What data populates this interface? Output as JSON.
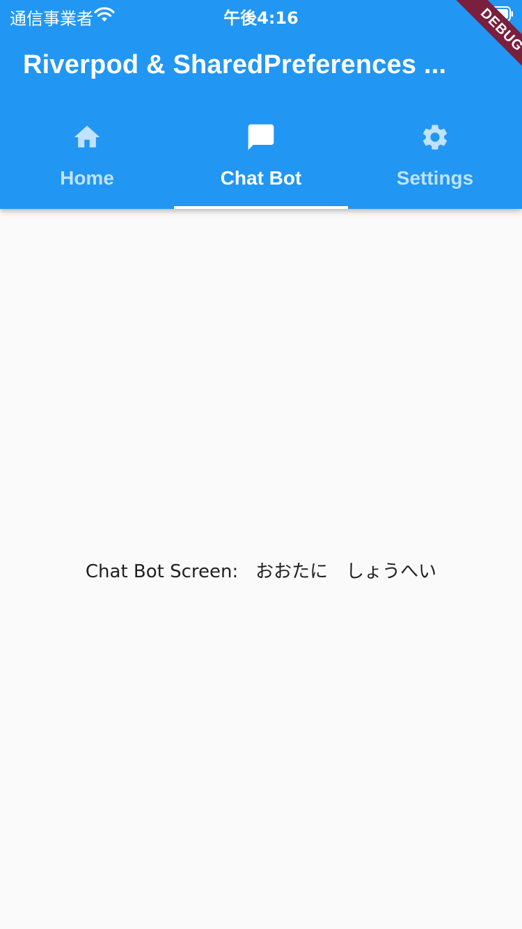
{
  "status_bar": {
    "carrier": "通信事業者",
    "time": "午後4:16",
    "wifi_icon": "wifi-icon",
    "battery_icon": "battery-icon"
  },
  "app_bar": {
    "title": "Riverpod & SharedPreferences ...",
    "background_color": "#2196F3"
  },
  "tabs": [
    {
      "label": "Home",
      "icon": "home-icon",
      "active": false
    },
    {
      "label": "Chat Bot",
      "icon": "chat-bubble-icon",
      "active": true
    },
    {
      "label": "Settings",
      "icon": "gear-icon",
      "active": false
    }
  ],
  "debug_banner": {
    "label": "DEBUG",
    "color": "#7a1f3d"
  },
  "body": {
    "text": "Chat Bot Screen:   おおたに　しょうへい"
  }
}
